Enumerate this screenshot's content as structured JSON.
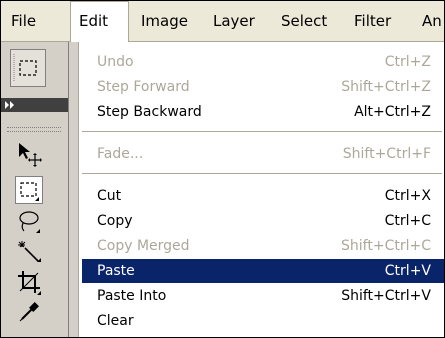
{
  "menubar": {
    "items": [
      "File",
      "Edit",
      "Image",
      "Layer",
      "Select",
      "Filter",
      "An"
    ],
    "active_index": 1
  },
  "tools": {
    "items": [
      {
        "icon": "marquee-options-icon"
      },
      {
        "icon": "expand-arrows-icon"
      },
      {
        "icon": "move-tool-icon"
      },
      {
        "icon": "rectangular-marquee-icon"
      },
      {
        "icon": "lasso-icon"
      },
      {
        "icon": "magic-wand-icon"
      },
      {
        "icon": "crop-icon"
      },
      {
        "icon": "eyedropper-icon"
      }
    ]
  },
  "edit_menu": {
    "items": [
      {
        "label": "Undo",
        "shortcut": "Ctrl+Z",
        "state": "disabled"
      },
      {
        "label": "Step Forward",
        "shortcut": "Shift+Ctrl+Z",
        "state": "disabled"
      },
      {
        "label": "Step Backward",
        "shortcut": "Alt+Ctrl+Z",
        "state": "enabled"
      },
      {
        "label": "Fade...",
        "shortcut": "Shift+Ctrl+F",
        "state": "disabled"
      },
      {
        "label": "Cut",
        "shortcut": "Ctrl+X",
        "state": "enabled"
      },
      {
        "label": "Copy",
        "shortcut": "Ctrl+C",
        "state": "enabled"
      },
      {
        "label": "Copy Merged",
        "shortcut": "Shift+Ctrl+C",
        "state": "disabled"
      },
      {
        "label": "Paste",
        "shortcut": "Ctrl+V",
        "state": "highlighted"
      },
      {
        "label": "Paste Into",
        "shortcut": "Shift+Ctrl+V",
        "state": "enabled"
      },
      {
        "label": "Clear",
        "shortcut": "",
        "state": "enabled"
      }
    ]
  },
  "colors": {
    "menubar_bg": "#ece9d8",
    "highlight_bg": "#0a246a",
    "highlight_text": "#ffffff",
    "disabled_text": "#aca899",
    "toolbar_bg": "#d4d0c8"
  }
}
